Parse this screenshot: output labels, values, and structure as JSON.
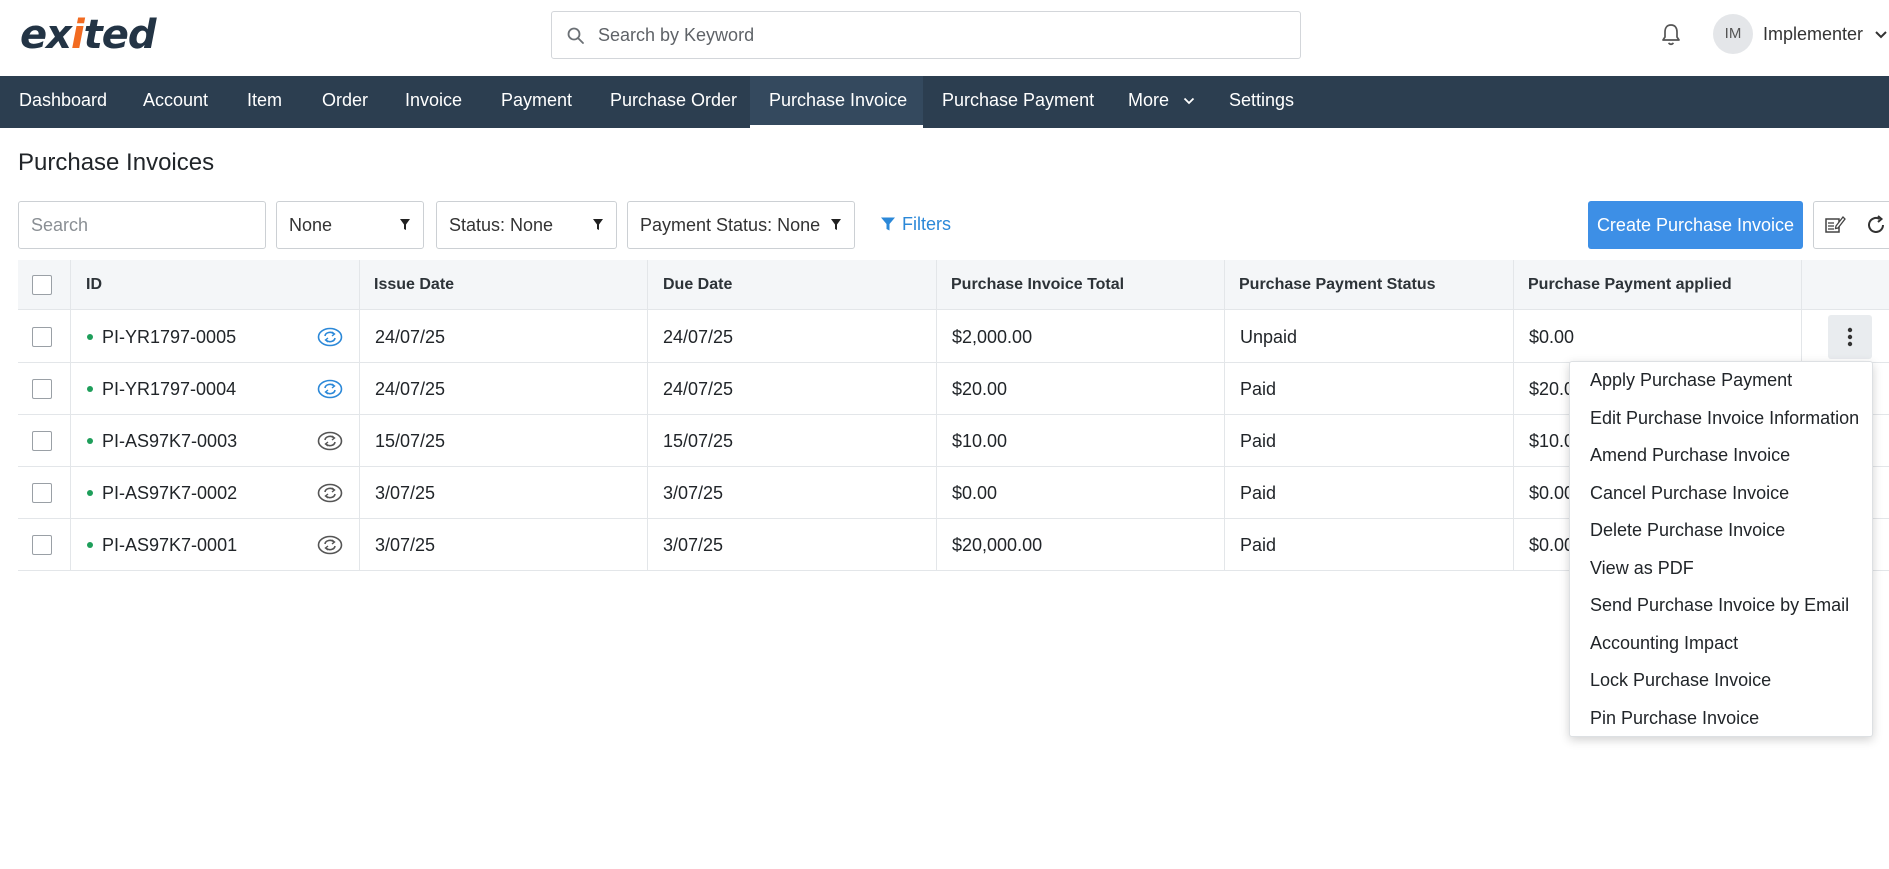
{
  "header": {
    "logo_text_a": "ex",
    "logo_text_b": "i",
    "logo_text_c": "ted",
    "search_placeholder": "Search by Keyword",
    "avatar_initials": "IM",
    "user_name": "Implementer"
  },
  "nav": {
    "items": [
      {
        "label": "Dashboard"
      },
      {
        "label": "Account"
      },
      {
        "label": "Item"
      },
      {
        "label": "Order"
      },
      {
        "label": "Invoice"
      },
      {
        "label": "Payment"
      },
      {
        "label": "Purchase Order"
      },
      {
        "label": "Purchase Invoice",
        "active": true
      },
      {
        "label": "Purchase Payment"
      },
      {
        "label": "More"
      },
      {
        "label": "Settings"
      }
    ]
  },
  "page": {
    "title": "Purchase Invoices"
  },
  "toolbar": {
    "search_placeholder": "Search",
    "filter_none": "None",
    "status_filter": "Status: None",
    "payment_status_filter": "Payment Status: None",
    "filters_link": "Filters",
    "create_button": "Create Purchase Invoice"
  },
  "table": {
    "columns": [
      "ID",
      "Issue Date",
      "Due Date",
      "Purchase Invoice Total",
      "Purchase Payment Status",
      "Purchase Payment applied"
    ],
    "rows": [
      {
        "id": "PI-YR1797-0005",
        "issue_date": "24/07/25",
        "due_date": "24/07/25",
        "total": "$2,000.00",
        "status": "Unpaid",
        "applied": "$0.00",
        "sync": "blue"
      },
      {
        "id": "PI-YR1797-0004",
        "issue_date": "24/07/25",
        "due_date": "24/07/25",
        "total": "$20.00",
        "status": "Paid",
        "applied": "$20.0",
        "sync": "blue"
      },
      {
        "id": "PI-AS97K7-0003",
        "issue_date": "15/07/25",
        "due_date": "15/07/25",
        "total": "$10.00",
        "status": "Paid",
        "applied": "$10.0",
        "sync": "gray"
      },
      {
        "id": "PI-AS97K7-0002",
        "issue_date": "3/07/25",
        "due_date": "3/07/25",
        "total": "$0.00",
        "status": "Paid",
        "applied": "$0.00",
        "sync": "gray"
      },
      {
        "id": "PI-AS97K7-0001",
        "issue_date": "3/07/25",
        "due_date": "3/07/25",
        "total": "$20,000.00",
        "status": "Paid",
        "applied": "$0.00",
        "sync": "gray"
      }
    ]
  },
  "row_menu": {
    "items": [
      "Apply Purchase Payment",
      "Edit Purchase Invoice Information",
      "Amend Purchase Invoice",
      "Cancel Purchase Invoice",
      "Delete Purchase Invoice",
      "View as PDF",
      "Send Purchase Invoice by Email",
      "Accounting Impact",
      "Lock Purchase Invoice",
      "Pin Purchase Invoice"
    ]
  },
  "colors": {
    "nav_bg": "#2c3e50",
    "primary": "#3d8fe6",
    "link": "#2b88d8",
    "status_dot": "#1e9e5a",
    "sync_blue": "#2b88d8",
    "sync_gray": "#555555"
  },
  "icons": [
    "search-icon",
    "bell-icon",
    "chevron-down-icon",
    "filter-icon",
    "edit-columns-icon",
    "refresh-icon",
    "sync-icon",
    "kebab-icon"
  ]
}
